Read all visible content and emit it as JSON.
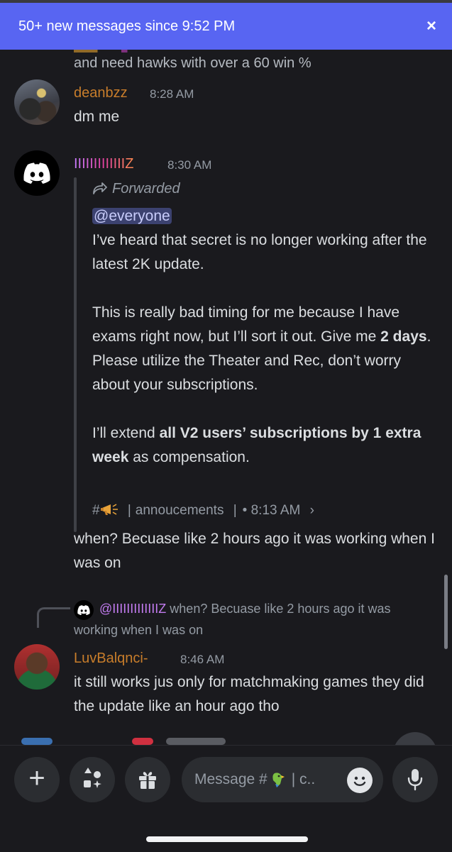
{
  "banner": {
    "text": "50+ new messages since 9:52 PM",
    "close_icon": "×"
  },
  "prev_message": {
    "tail": "and need hawks with over a 60 win %"
  },
  "messages": [
    {
      "username": "deanbzz",
      "username_color": "#c87d2b",
      "time": "8:28 AM",
      "text": "dm me"
    },
    {
      "username": "IIIIIIIIIIIIIZ",
      "username_gradient": [
        "#c77dff",
        "#e040a0",
        "#ff8a50"
      ],
      "time": "8:30 AM",
      "forward": {
        "label": "Forwarded",
        "mention": "@everyone",
        "lines": [
          "I’ve heard that secret is no longer working after the latest 2K update."
        ],
        "para2_pre": "This is really bad timing for me because I have exams right now, but I’ll sort it out. Give me ",
        "para2_bold": "2 days",
        "para2_post": ". Please utilize the Theater and Rec, don’t worry about your subscriptions.",
        "para3_pre": "I’ll extend ",
        "para3_bold": "all V2 users’ subscriptions by 1 extra week",
        "para3_post": " as compensation.",
        "channel_hash": "#",
        "channel": "annoucements",
        "meta_time": "• 8:13 AM",
        "chevron": "›"
      },
      "followup": "when? Becuase like 2 hours ago it was working when I was on"
    },
    {
      "reply": {
        "name": "@IIIIIIIIIIIIIZ",
        "text": "when? Becuase like 2 hours ago it was working when I was on"
      },
      "username": "LuvBalqnci-",
      "username_color": "#c87d2b",
      "time": "8:46 AM",
      "text": "it still works jus only for matchmaking games they did the update like an hour ago tho"
    }
  ],
  "composer": {
    "placeholder_pre": "Message #",
    "placeholder_post": " | c..",
    "add_icon": "+",
    "apps_icon": "apps-icon",
    "gift_icon": "gift-icon",
    "emoji_icon": "emoji-icon",
    "mic_icon": "mic-icon"
  },
  "colors": {
    "background": "#1a1a1e",
    "banner": "#5865f2",
    "mention_bg": "#3c4270",
    "input_bg": "#2b2d31"
  }
}
